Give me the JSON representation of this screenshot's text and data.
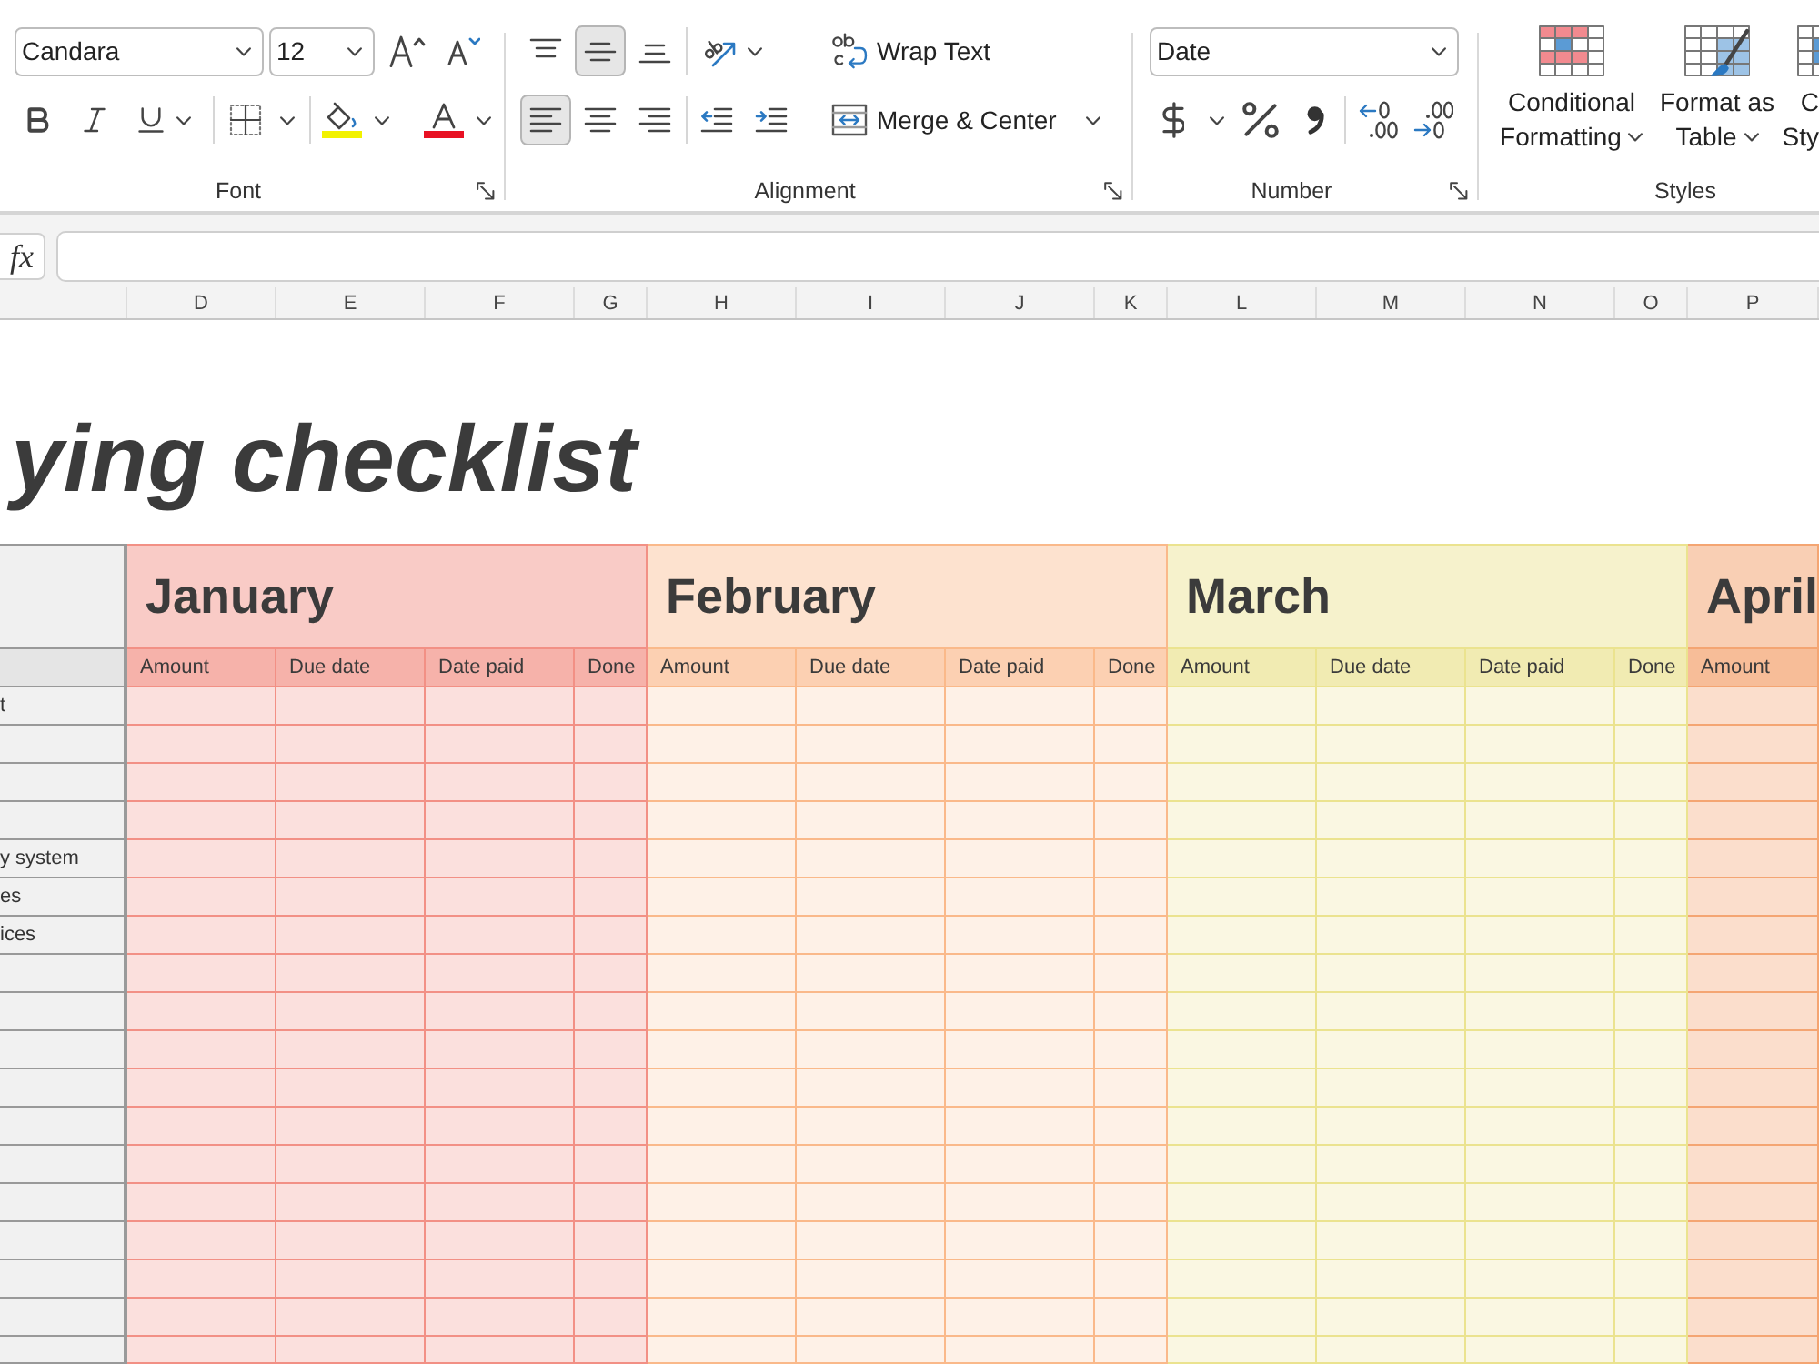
{
  "ribbon": {
    "font": {
      "name": "Candara",
      "size": "12",
      "label": "Font"
    },
    "alignment": {
      "vertical": [
        {
          "kind": "top",
          "selected": false
        },
        {
          "kind": "middle",
          "selected": true
        },
        {
          "kind": "bottom",
          "selected": false
        }
      ],
      "horizontal": [
        {
          "kind": "left",
          "selected": true
        },
        {
          "kind": "center",
          "selected": false
        },
        {
          "kind": "right",
          "selected": false
        }
      ],
      "wrap_text": "Wrap Text",
      "merge": "Merge & Center",
      "label": "Alignment"
    },
    "number": {
      "format": "Date",
      "label": "Number"
    },
    "styles": {
      "buttons": [
        {
          "kind": "conditional",
          "lines": [
            "Conditional",
            "Formatting"
          ]
        },
        {
          "kind": "table",
          "lines": [
            "Format as",
            "Table"
          ]
        },
        {
          "kind": "cell",
          "lines": [
            "C",
            "Sty"
          ]
        }
      ],
      "label": "Styles"
    }
  },
  "formula_bar": {
    "function_label": "fx"
  },
  "column_headers": [
    "D",
    "E",
    "F",
    "G",
    "H",
    "I",
    "J",
    "K",
    "L",
    "M",
    "N",
    "O",
    "P"
  ],
  "sheet": {
    "title": "ying checklist",
    "months": [
      {
        "name": "January",
        "color": "#f9cbc6",
        "columns": [
          "Amount",
          "Due date",
          "Date paid",
          "Done"
        ]
      },
      {
        "name": "February",
        "color": "#fde2cf",
        "columns": [
          "Amount",
          "Due date",
          "Date paid",
          "Done"
        ]
      },
      {
        "name": "March",
        "color": "#f6f2cc",
        "columns": [
          "Amount",
          "Due date",
          "Date paid",
          "Done"
        ]
      },
      {
        "name": "April",
        "color": "#f9cfb4",
        "columns": [
          "Amount"
        ]
      }
    ],
    "rows": [
      {
        "label": "t"
      },
      {},
      {},
      {},
      {
        "label": "y system"
      },
      {
        "label": "es"
      },
      {
        "label": "ices"
      },
      {},
      {},
      {},
      {},
      {},
      {},
      {},
      {},
      {},
      {},
      {}
    ]
  }
}
